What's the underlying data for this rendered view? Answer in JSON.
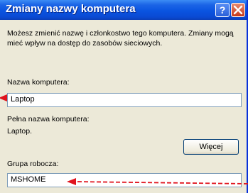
{
  "window": {
    "title": "Zmiany nazwy komputera",
    "help_glyph": "?",
    "close_glyph": "×"
  },
  "dialog": {
    "description": "Możesz zmienić nazwę i członkostwo tego komputera. Zmiany mogą mieć wpływ na dostęp do zasobów sieciowych.",
    "computer_name_label": "Nazwa komputera:",
    "computer_name_value": "Laptop",
    "full_name_label": "Pełna nazwa komputera:",
    "full_name_value": "Laptop.",
    "more_button": "Więcej",
    "workgroup_label": "Grupa robocza:",
    "workgroup_value": "MSHOME"
  },
  "colors": {
    "titlebar": "#0a54e0",
    "dialog_bg": "#ece9d8",
    "annotation_arrow": "#e0141e"
  },
  "icons": [
    "help-icon",
    "close-icon"
  ]
}
